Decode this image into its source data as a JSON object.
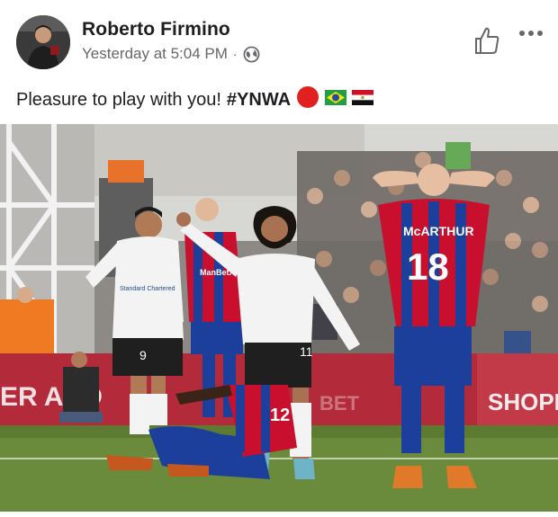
{
  "post": {
    "author": "Roberto Firmino",
    "timestamp": "Yesterday at 5:04 PM",
    "separator": "·",
    "privacy_icon": "globe-icon",
    "text": "Pleasure to play with you!",
    "hashtag": "#YNWA",
    "emojis": [
      "red-circle",
      "brazil-flag",
      "egypt-flag"
    ]
  },
  "actions": {
    "like_icon": "thumbs-up-icon",
    "more_icon": "more-options-icon"
  },
  "photo": {
    "player_left_number": "9",
    "player_center_number": "11",
    "player_ground_number": "12",
    "player_right_name": "McARTHUR",
    "player_right_number": "18",
    "board_left_text": "ER AND",
    "board_right_text": "SHOPP",
    "board_mid_text": "BET",
    "sponsor_text": "Standard Chartered",
    "opponent_sponsor": "ManBetX"
  },
  "colors": {
    "liverpool_kit": "#f3f3f3",
    "palace_red": "#c8102e",
    "palace_blue": "#1b3f9a",
    "pitch": "#6a8a3c",
    "board": "#b32a3a"
  }
}
